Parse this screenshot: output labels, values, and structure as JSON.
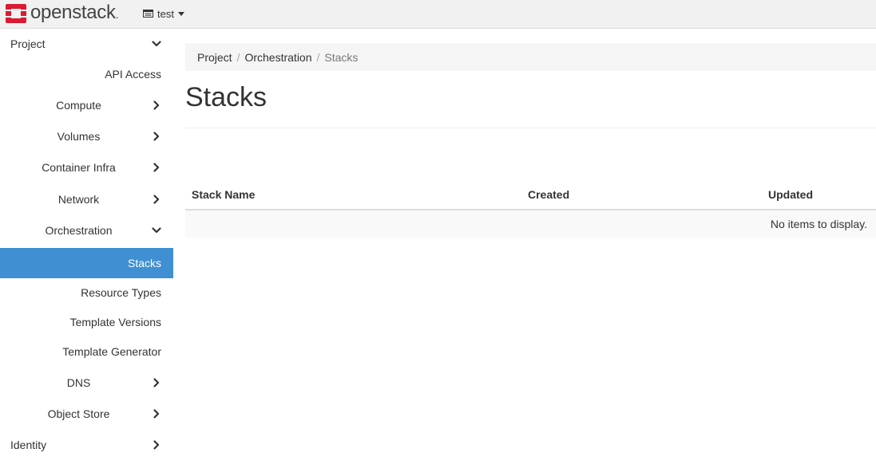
{
  "brand": {
    "name": "openstack",
    "suffix": "."
  },
  "header": {
    "project": "test"
  },
  "sidebar": {
    "project_label": "Project",
    "api_access": "API Access",
    "compute": "Compute",
    "volumes": "Volumes",
    "container_infra": "Container Infra",
    "network": "Network",
    "orchestration": "Orchestration",
    "stacks": "Stacks",
    "resource_types": "Resource Types",
    "template_versions": "Template Versions",
    "template_generator": "Template Generator",
    "dns": "DNS",
    "object_store": "Object Store",
    "identity": "Identity"
  },
  "breadcrumb": [
    "Project",
    "Orchestration",
    "Stacks"
  ],
  "page": {
    "title": "Stacks"
  },
  "table": {
    "columns": [
      "Stack Name",
      "Created",
      "Updated"
    ],
    "empty_message": "No items to display."
  },
  "colors": {
    "accent": "#3f8fd2",
    "logo_red": "#da1a32",
    "navbar_bg": "#f1f1f1"
  },
  "icons": {
    "logo": "openstack-logo-icon",
    "project": "project-icon",
    "caret": "caret-down-icon",
    "expand": "chevron-right-icon",
    "collapse": "chevron-down-icon"
  }
}
